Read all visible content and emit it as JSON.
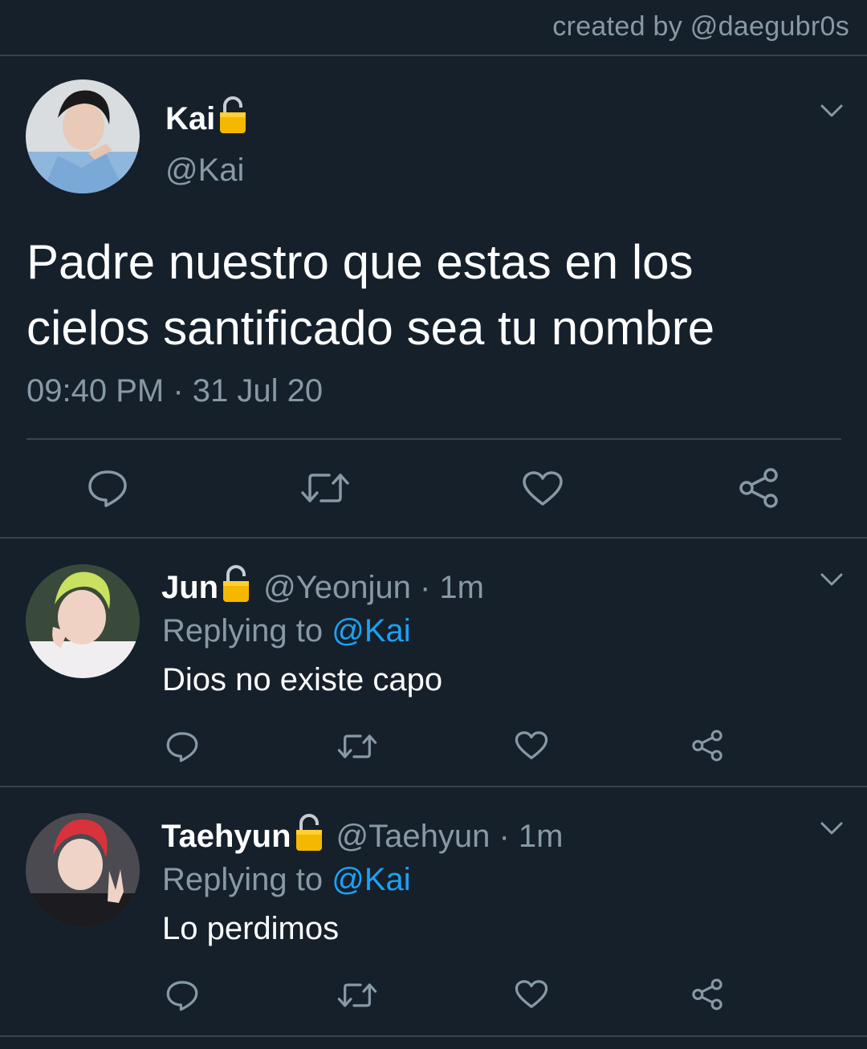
{
  "watermark": "created by @daegubr0s",
  "main_tweet": {
    "display_name": "Kai",
    "handle": "@Kai",
    "text_line1": "Padre nuestro que estas en los",
    "text_line2": "cielos santificado sea tu nombre",
    "timestamp": "09:40 PM · 31 Jul 20"
  },
  "replies": [
    {
      "display_name": "Jun",
      "handle_time": "@Yeonjun · 1m",
      "replying_prefix": "Replying to ",
      "replying_to": "@Kai",
      "text": "Dios no existe capo"
    },
    {
      "display_name": "Taehyun",
      "handle_time": "@Taehyun · 1m",
      "replying_prefix": "Replying to ",
      "replying_to": "@Kai",
      "text": "Lo perdimos"
    }
  ],
  "icons": {
    "reply": "speech-bubble-icon",
    "retweet": "retweet-icon",
    "like": "heart-icon",
    "share": "share-icon",
    "lock": "lock-icon",
    "more": "chevron-down-icon"
  },
  "colors": {
    "background": "#15202b",
    "divider": "#38444d",
    "secondary_text": "#8899a6",
    "accent": "#1da1f2",
    "lock": "#f5b800"
  }
}
